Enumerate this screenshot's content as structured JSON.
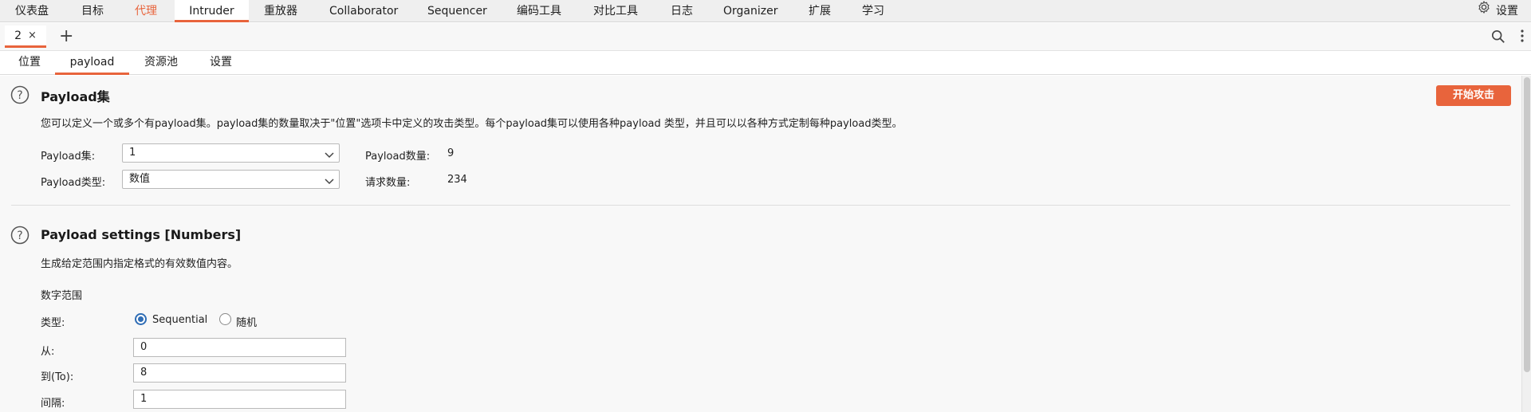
{
  "menu": {
    "items": [
      "仪表盘",
      "目标",
      "代理",
      "Intruder",
      "重放器",
      "Collaborator",
      "Sequencer",
      "编码工具",
      "对比工具",
      "日志",
      "Organizer",
      "扩展",
      "学习"
    ],
    "settings_label": "设置"
  },
  "tabs": {
    "request_tab": "2",
    "close_glyph": "×",
    "add_glyph": "+"
  },
  "subtabs": [
    "位置",
    "payload",
    "资源池",
    "设置"
  ],
  "payload_sets": {
    "title": "Payload集",
    "description": "您可以定义一个或多个有payload集。payload集的数量取决于\"位置\"选项卡中定义的攻击类型。每个payload集可以使用各种payload 类型，并且可以以各种方式定制每种payload类型。",
    "start_attack": "开始攻击",
    "set_label": "Payload集:",
    "set_value": "1",
    "type_label": "Payload类型:",
    "type_value": "数值",
    "count_label": "Payload数量:",
    "count_value": "9",
    "request_count_label": "请求数量:",
    "request_count_value": "234"
  },
  "payload_settings": {
    "title": "Payload settings [Numbers]",
    "description": "生成给定范围内指定格式的有效数值内容。",
    "range_heading": "数字范围",
    "type_label": "类型:",
    "option_sequential": "Sequential",
    "option_random": "随机",
    "selected": "Sequential",
    "from_label": "从:",
    "from_value": "0",
    "to_label": "到(To):",
    "to_value": "8",
    "step_label": "间隔:",
    "step_value": "1"
  },
  "colors": {
    "accent": "#e8643c",
    "radio": "#2f6db5"
  }
}
